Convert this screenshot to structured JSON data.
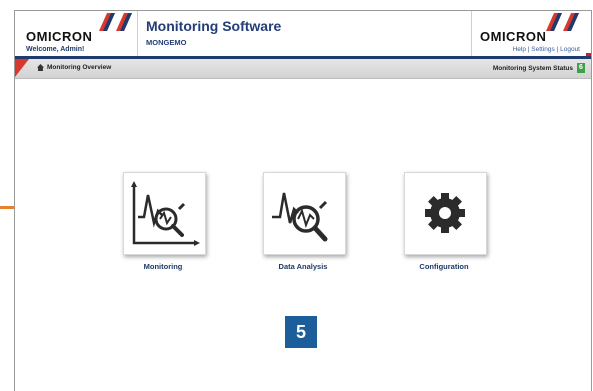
{
  "header": {
    "brand": "OMICRON",
    "welcome": "Welcome, Admin!",
    "app_title": "Monitoring Software",
    "app_subtitle": "MONGEMO",
    "brand_right": "OMICRON",
    "links": [
      "Help",
      "Settings",
      "Logout"
    ],
    "link_separator": " | "
  },
  "navbar": {
    "breadcrumb": "Monitoring Overview",
    "status_label": "Monitoring System Status",
    "status_value": "6"
  },
  "tiles": [
    {
      "label": "Monitoring",
      "icon": "monitoring-icon"
    },
    {
      "label": "Data Analysis",
      "icon": "data-analysis-icon"
    },
    {
      "label": "Configuration",
      "icon": "gear-icon"
    }
  ],
  "step_badge": "5",
  "colors": {
    "brand_blue": "#233d77",
    "accent_red": "#d63a2f",
    "status_green": "#3ea24a",
    "badge_blue": "#1b5e99",
    "orange_marker": "#e8822a"
  }
}
